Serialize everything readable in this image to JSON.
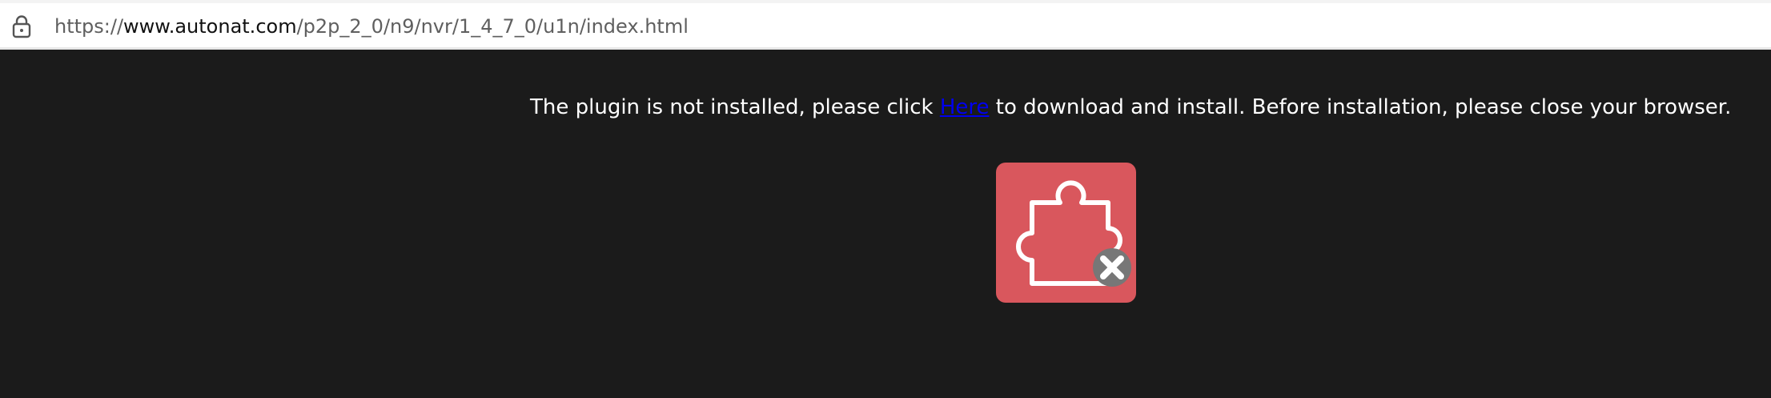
{
  "browser": {
    "url_prefix": "https://",
    "url_domain": "www.autonat.com",
    "url_path": "/p2p_2_0/n9/nvr/1_4_7_0/u1n/index.html",
    "lock_icon": "lock-icon"
  },
  "page": {
    "message_before": "The plugin is not installed, please click ",
    "link_text": "Here",
    "message_after": " to download and install. Before installation, please close your browser.",
    "plugin_icon": "plugin-missing-icon"
  },
  "colors": {
    "background": "#1b1b1b",
    "link": "#0000ee",
    "plugin_tile": "#d9575d",
    "close_badge": "#777777"
  }
}
